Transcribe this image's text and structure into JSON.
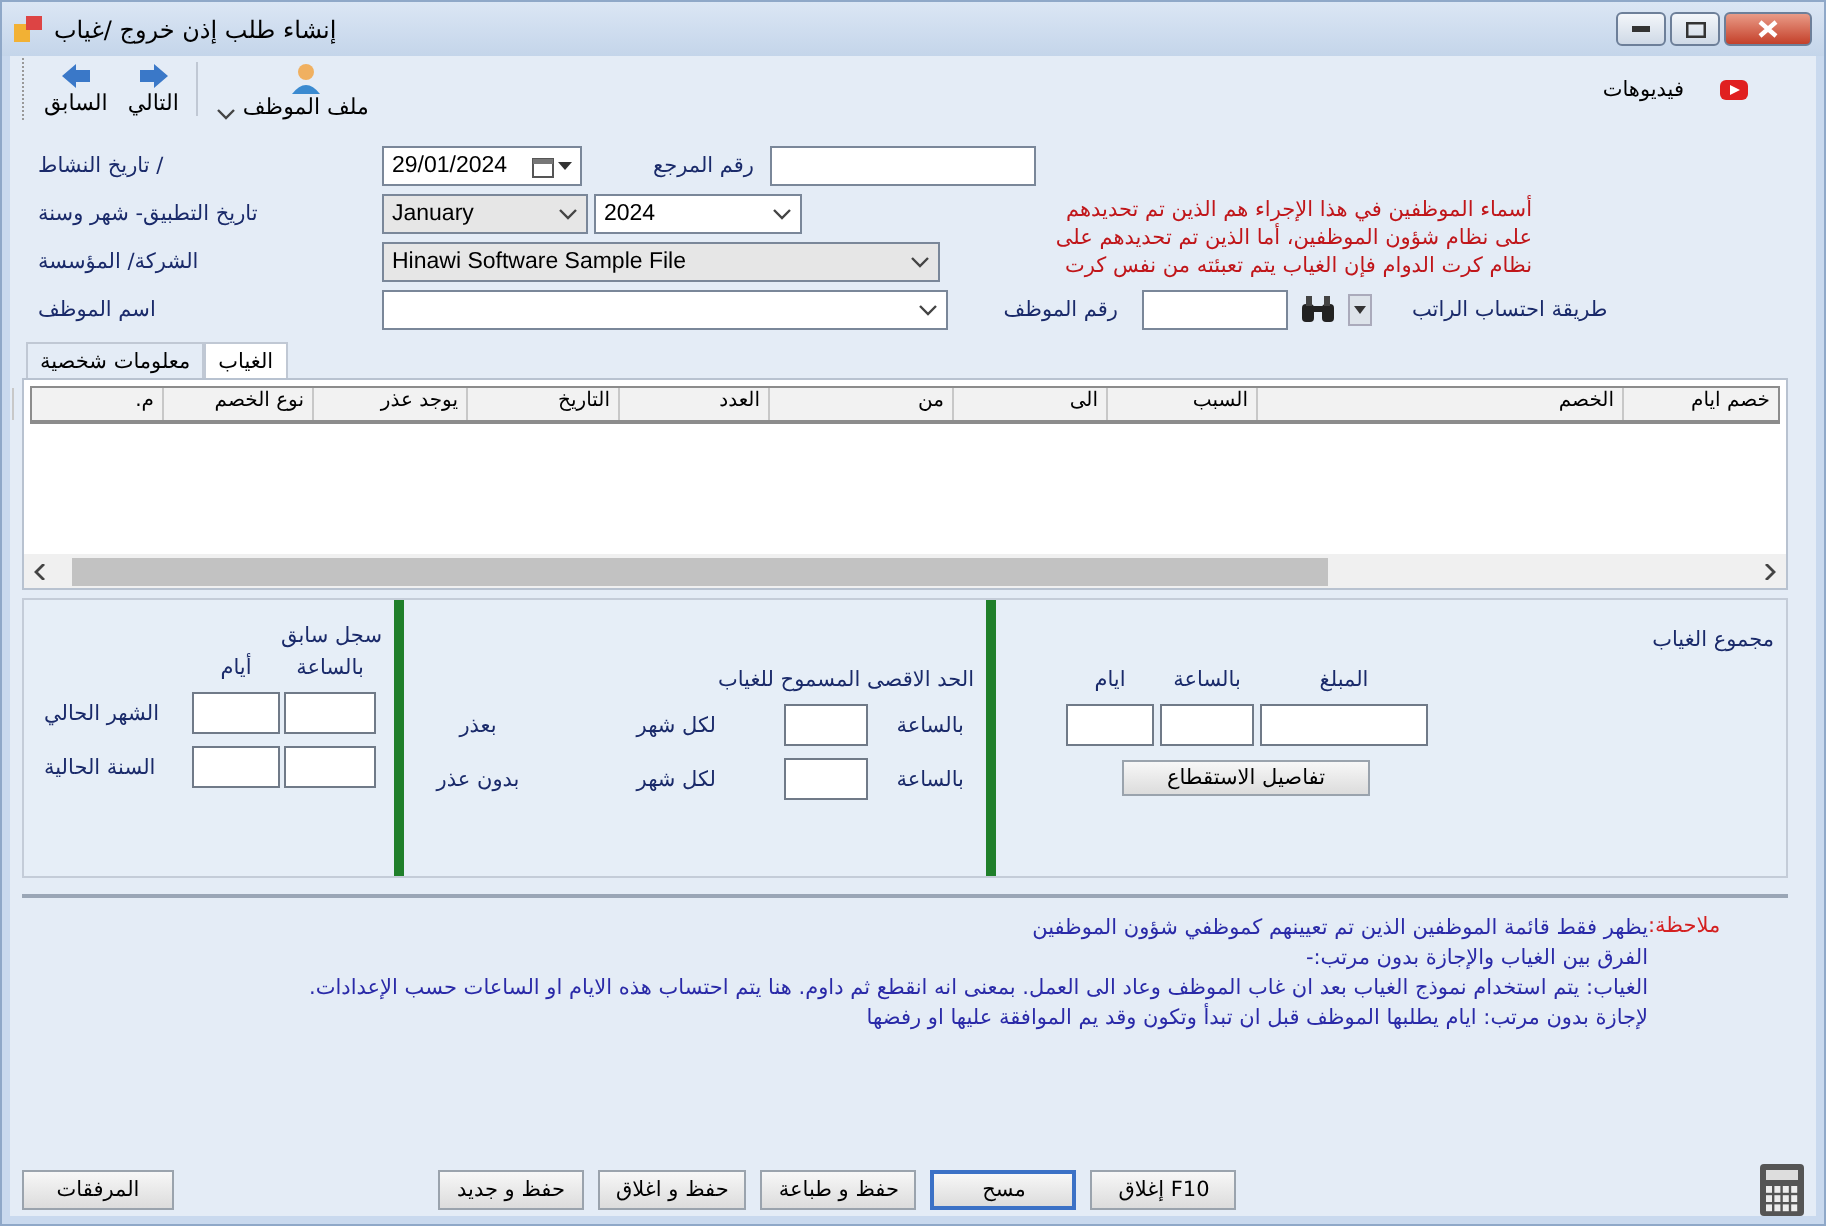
{
  "window": {
    "title": "إنشاء طلب إذن خروج /غياب"
  },
  "toolbar": {
    "buttons": [
      {
        "label": "ملف الموظف",
        "kind": "employee"
      },
      {
        "label": "التالي",
        "kind": "next"
      },
      {
        "label": "السابق",
        "kind": "back"
      }
    ],
    "videos": "فيديوهات"
  },
  "form": {
    "activity_date": {
      "label": "/ تاريخ النشاط",
      "value": "29/01/2024"
    },
    "reference": {
      "label": "رقم المرجع"
    },
    "apply_period": {
      "label": "تاريخ التطبيق- شهر وسنة",
      "month": "January",
      "year": "2024"
    },
    "company": {
      "label": "الشركة/ المؤسسة",
      "value": "Hinawi Software Sample File"
    },
    "employee_name": {
      "label": "اسم الموظف"
    },
    "employee_number": {
      "label": "رقم الموظف"
    },
    "salary_method": {
      "label": "طريقة احتساب الراتب"
    },
    "notice_lines": [
      "أسماء الموظفين في هذا الإجراء هم الذين تم تحديدهم",
      "على نظام شؤون الموظفين،  أما الذين تم تحديدهم على",
      "نظام كرت الدوام فإن الغياب يتم تعبئته من نفس كرت"
    ]
  },
  "tabs": [
    {
      "label": "الغياب",
      "selected": true
    },
    {
      "label": "معلومات شخصية",
      "selected": false
    }
  ],
  "table": {
    "columns": [
      "خصم ايام",
      "الخصم",
      "السبب",
      "الى",
      "من",
      "العدد",
      "التاريخ",
      "يوجد عذر",
      "نوع الخصم",
      "م."
    ]
  },
  "previous_record": {
    "title": "سجل سابق",
    "headers": [
      "بالساعة",
      "أيام"
    ],
    "rows": [
      "الشهر الحالي",
      "السنة الحالية"
    ]
  },
  "max_allowed": {
    "title": "الحد الاقصى المسموح للغياب",
    "rows": [
      {
        "label": "بعذر",
        "period": "لكل شهر",
        "unit": "بالساعة"
      },
      {
        "label": "بدون عذر",
        "period": "لكل شهر",
        "unit": "بالساعة"
      }
    ]
  },
  "absence_total": {
    "title": "مجموع الغياب",
    "headers": [
      "المبلغ",
      "بالساعة",
      "ايام"
    ],
    "button": "تفاصيل الاستقطاع"
  },
  "notes": {
    "label": "ملاحظة:",
    "lines": [
      "يظهر فقط قائمة الموظفين الذين تم تعيينهم كموظفي شؤون الموظفين",
      "الفرق بين الغياب والإجازة بدون مرتب:-",
      "الغياب: يتم استخدام نموذج الغياب بعد ان غاب الموظف وعاد الى العمل. بمعنى انه انقطع ثم داوم. هنا يتم احتساب هذه الايام او الساعات حسب الإعدادات.",
      "لإجازة بدون مرتب: ايام يطلبها الموظف قبل ان تبدأ وتكون وقد يم الموافقة عليها او رفضها"
    ]
  },
  "footer": {
    "attachments": "المرفقات",
    "buttons": [
      {
        "label": "F10 إغلاق",
        "focused": false
      },
      {
        "label": "مسح",
        "focused": true
      },
      {
        "label": "حفظ و طباعة",
        "focused": false
      },
      {
        "label": "حفظ و اغلاق",
        "focused": false
      },
      {
        "label": "حفظ و جديد",
        "focused": false
      }
    ]
  }
}
